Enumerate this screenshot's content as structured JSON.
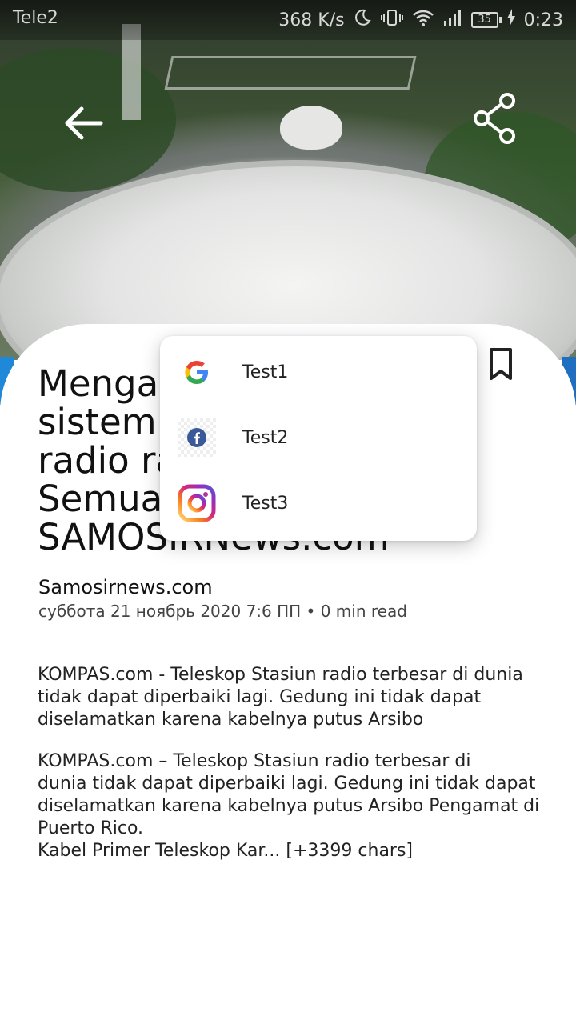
{
  "status_bar": {
    "carrier": "Tele2",
    "speed": "368 K/s",
    "battery": "35",
    "time": "0:23"
  },
  "header": {
    "back_icon": "arrow-left-icon",
    "share_icon": "share-icon"
  },
  "article": {
    "title_lines": [
      "Mengap",
      "sistem r",
      "radio ra",
      "Semua",
      "SAMOSIRNews.com"
    ],
    "source": "Samosirnews.com",
    "meta": "суббота 21 ноябрь 2020 7:6 ПП • 0 min read",
    "paragraph1": "KOMPAS.com - Teleskop Stasiun radio terbesar di dunia tidak dapat diperbaiki lagi. Gedung ini tidak dapat diselamatkan karena kabelnya putus Arsibo",
    "paragraph2_lines": [
      "KOMPAS.com – Teleskop Stasiun radio terbesar di",
      "dunia tidak dapat diperbaiki lagi. Gedung ini tidak dapat",
      "diselamatkan karena kabelnya putus Arsibo Pengamat di",
      "Puerto Rico.",
      "Kabel Primer Teleskop Kar... [+3399 chars]"
    ]
  },
  "popup_menu": {
    "items": [
      {
        "label": "Test1",
        "icon": "google-icon"
      },
      {
        "label": "Test2",
        "icon": "facebook-icon"
      },
      {
        "label": "Test3",
        "icon": "instagram-icon"
      }
    ]
  },
  "colors": {
    "accent_blue": "#1f88d8",
    "facebook_blue": "#3b5998"
  }
}
